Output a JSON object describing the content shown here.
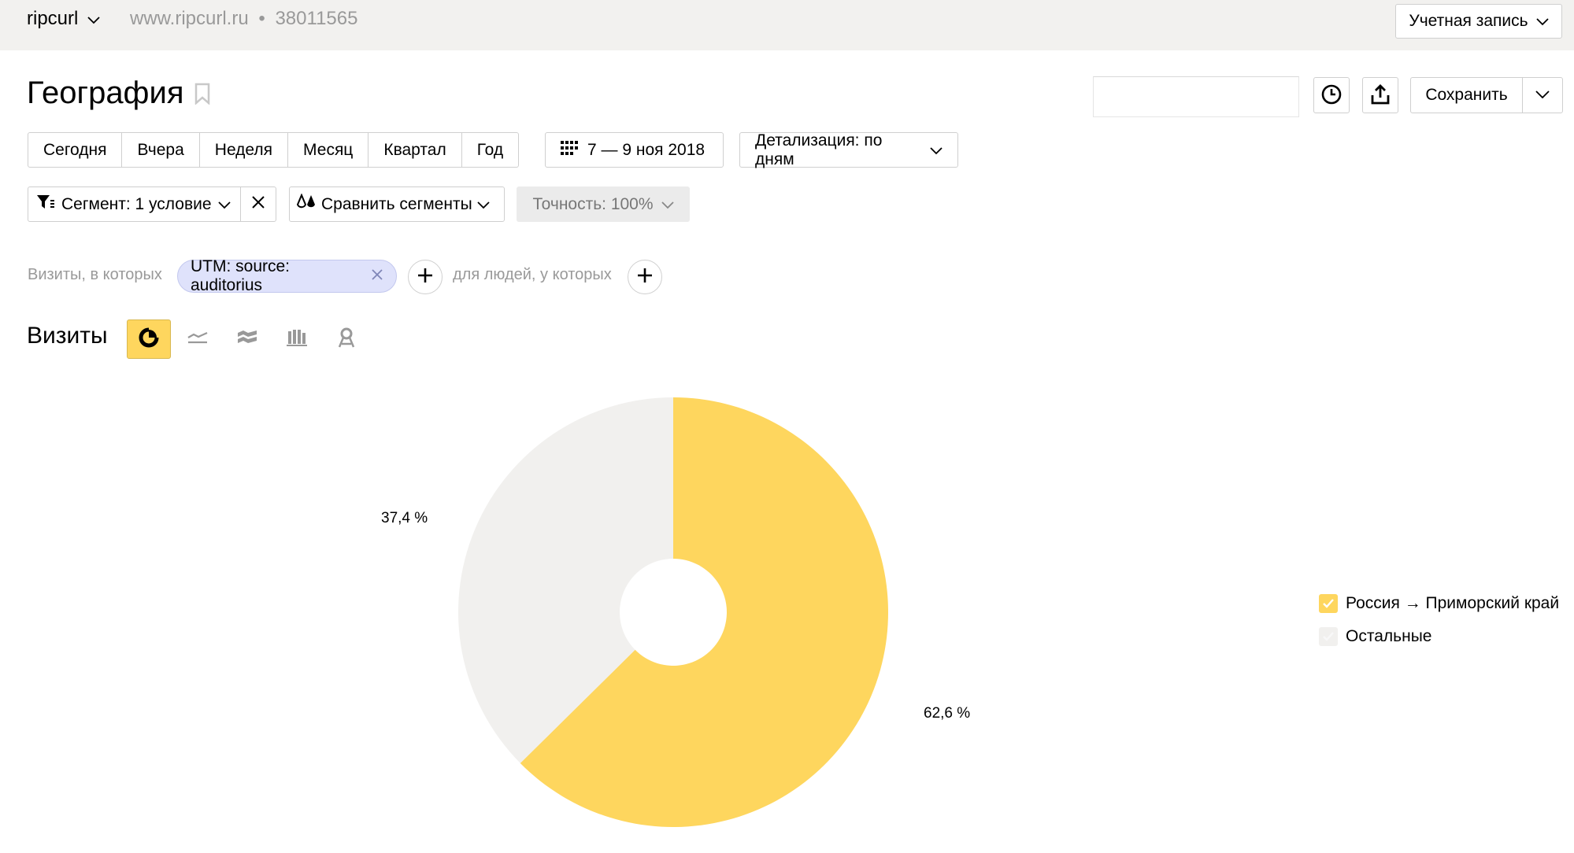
{
  "topbar": {
    "counter_name": "ripcurl",
    "site_url": "www.ripcurl.ru",
    "separator": "•",
    "counter_id": "38011565",
    "account_label": "Учетная запись"
  },
  "page": {
    "title": "География",
    "search_value": "",
    "save_label": "Сохранить"
  },
  "periods": [
    "Сегодня",
    "Вчера",
    "Неделя",
    "Месяц",
    "Квартал",
    "Год"
  ],
  "date_range": "7 — 9 ноя 2018",
  "detail_label": "Детализация: по дням",
  "segment": {
    "label": "Сегмент: 1 условие",
    "compare_label": "Сравнить сегменты",
    "accuracy_label": "Точность: 100%"
  },
  "conditions": {
    "visits_label": "Визиты, в которых",
    "tag": "UTM: source: auditorius",
    "people_label": "для людей, у которых"
  },
  "chart_section": {
    "title": "Визиты",
    "chart_types": [
      "pie-chart-icon",
      "line-chart-icon",
      "area-chart-icon",
      "bar-chart-icon",
      "map-icon"
    ],
    "active_type": "pie-chart-icon"
  },
  "colors": {
    "accent": "#fed65e",
    "other": "#f1f0ee",
    "tag_bg": "#dfe2fb"
  },
  "chart_data": {
    "type": "pie",
    "donut": true,
    "slices": [
      {
        "name": "Россия → Приморский край",
        "value": 62.6,
        "label": "62,6 %",
        "color": "#fed65e"
      },
      {
        "name": "Остальные",
        "value": 37.4,
        "label": "37,4 %",
        "color": "#f1f0ee"
      }
    ],
    "start_angle_deg": 0,
    "legend_position": "right"
  }
}
